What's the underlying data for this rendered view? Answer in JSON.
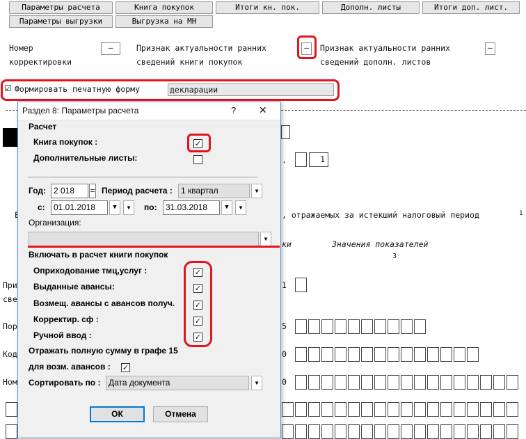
{
  "toolbar": {
    "row1": [
      "Параметры расчета",
      "Книга покупок",
      "Итоги кн. пок.",
      "Дополн. листы",
      "Итоги доп. лист."
    ],
    "row2": [
      "Параметры выгрузки",
      "Выгрузка на МН"
    ]
  },
  "form": {
    "correction_label_1": "Номер",
    "correction_label_2": "корректировки",
    "correction_value": "–",
    "relevance_book_label_1": "Признак актуальности ранних",
    "relevance_book_label_2": "сведений книги покупок",
    "relevance_book_value": "–",
    "relevance_add_label_1": "Признак актуальности ранних",
    "relevance_add_label_2": "сведений дополн. листов",
    "relevance_add_value": "–",
    "print_form_label": "Формировать печатную форму",
    "print_form_checked": "☑",
    "print_form_value": "декларации",
    "bg_dot": ".",
    "bg_one": "1",
    "bg_period_text": ", отражаемых за истекший налоговый период",
    "bg_period_sup": "1",
    "bg_col_header_a": "ки",
    "bg_col_header_b": "Значения показателей",
    "bg_col_num": "3",
    "bg_row_labels": [
      "При",
      "све",
      "Пор",
      "Код",
      "Ном"
    ],
    "bg_row_nums": [
      "1",
      "5",
      "0",
      "0"
    ],
    "bg_left_letter": "Е"
  },
  "dialog": {
    "title": "Раздел 8: Параметры расчета",
    "help": "?",
    "close": "✕",
    "section_calc": "Расчет",
    "purchase_book_label": "Книга покупок :",
    "purchase_book_checked": "✓",
    "additional_sheets_label": "Дополнительные листы:",
    "additional_sheets_checked": "",
    "year_label": "Год:",
    "year_value": "2 018",
    "year_eq": "=",
    "period_label": "Период расчета :",
    "period_value": "1 квартал",
    "from_label": "с:",
    "from_value": "01.01.2018",
    "to_label": "по:",
    "to_value": "31.03.2018",
    "org_label": "Организация:",
    "org_value": "",
    "include_label": "Включать в расчет книги покупок",
    "include_items": [
      {
        "label": "Оприходование тмц,услуг  :",
        "checked": "✓"
      },
      {
        "label": "Выданные авансы:",
        "checked": "✓"
      },
      {
        "label": "Возмещ. авансы с авансов получ.",
        "checked": "✓"
      },
      {
        "label": "Корректир. сф  :",
        "checked": "✓"
      },
      {
        "label": "Ручной ввод  :",
        "checked": "✓"
      }
    ],
    "full_sum_label_1": "Отражать полную сумму в графе 15",
    "full_sum_label_2": "для возм. авансов  :",
    "full_sum_checked": "✓",
    "sort_label": "Сортировать по :",
    "sort_value": "Дата документа",
    "ok_label": "ОК",
    "cancel_label": "Отмена"
  },
  "icons": {
    "dropdown": "▼",
    "spin_down": "▼"
  },
  "colors": {
    "annotation_red": "#e3141a",
    "dialog_border": "#5d8fd6",
    "focus_blue": "#0078d7"
  }
}
